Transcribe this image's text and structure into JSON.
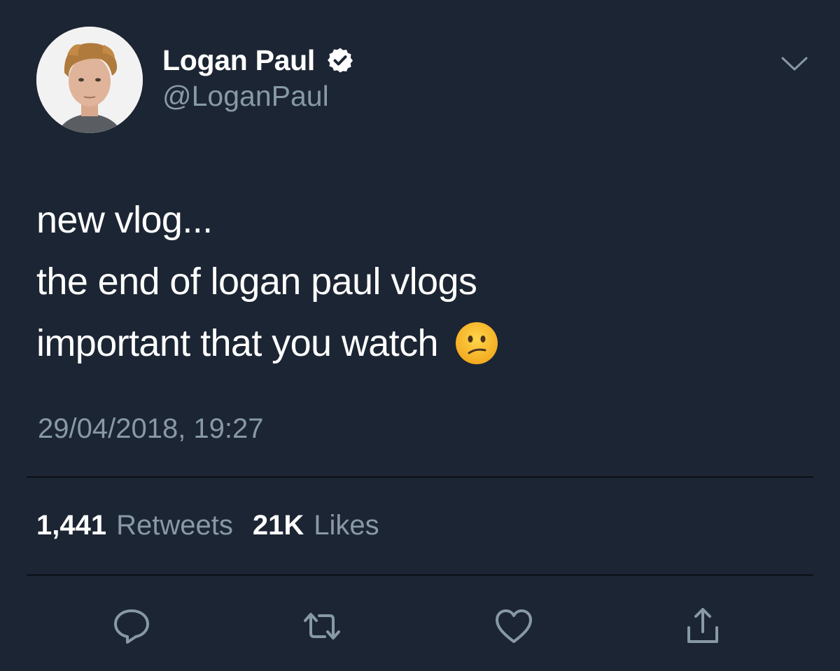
{
  "author": {
    "display_name": "Logan Paul",
    "handle": "@LoganPaul",
    "verified": true
  },
  "tweet": {
    "lines": [
      "new vlog...",
      "the end of logan paul vlogs",
      "important that you watch"
    ],
    "emoji": "confused-face",
    "timestamp": "29/04/2018, 19:27"
  },
  "stats": {
    "retweets_count": "1,441",
    "retweets_label": "Retweets",
    "likes_count": "21K",
    "likes_label": "Likes"
  },
  "actions": {
    "icons": [
      "reply-icon",
      "retweet-icon",
      "like-icon",
      "share-icon"
    ]
  },
  "theme": {
    "background": "#1c2533",
    "text_primary": "#ffffff",
    "text_secondary": "#8899a6",
    "divider": "#0b0f16"
  }
}
